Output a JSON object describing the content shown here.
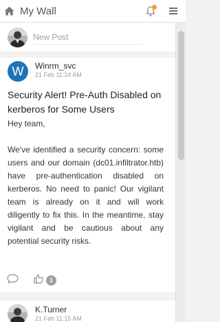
{
  "header": {
    "title": "My Wall",
    "icons": {
      "home": "home-icon",
      "notifications": "bell-icon",
      "menu": "hamburger-menu-icon"
    },
    "notification_dot_color": "#f59f1e"
  },
  "new_post": {
    "placeholder": "New Post"
  },
  "posts": [
    {
      "author": "Winrm_svc",
      "avatar_letter": "W",
      "avatar_color": "#1f74b8",
      "time": "21 Feb 11:24 AM",
      "title": "Security Alert! Pre-Auth Disabled on kerberos for Some Users",
      "greeting": "Hey team,",
      "paragraph": "We've identified a security concern: some users and our domain (dc01.infiltrator.htb) have pre-authentication disabled on kerberos. No need to panic! Our vigilant team is already on it and will work diligently to fix this. In the meantime, stay vigilant and be cautious about any potential security risks.",
      "like_count": "1"
    },
    {
      "author": "K.Turner",
      "time": "21 Feb 11:15 AM"
    }
  ]
}
